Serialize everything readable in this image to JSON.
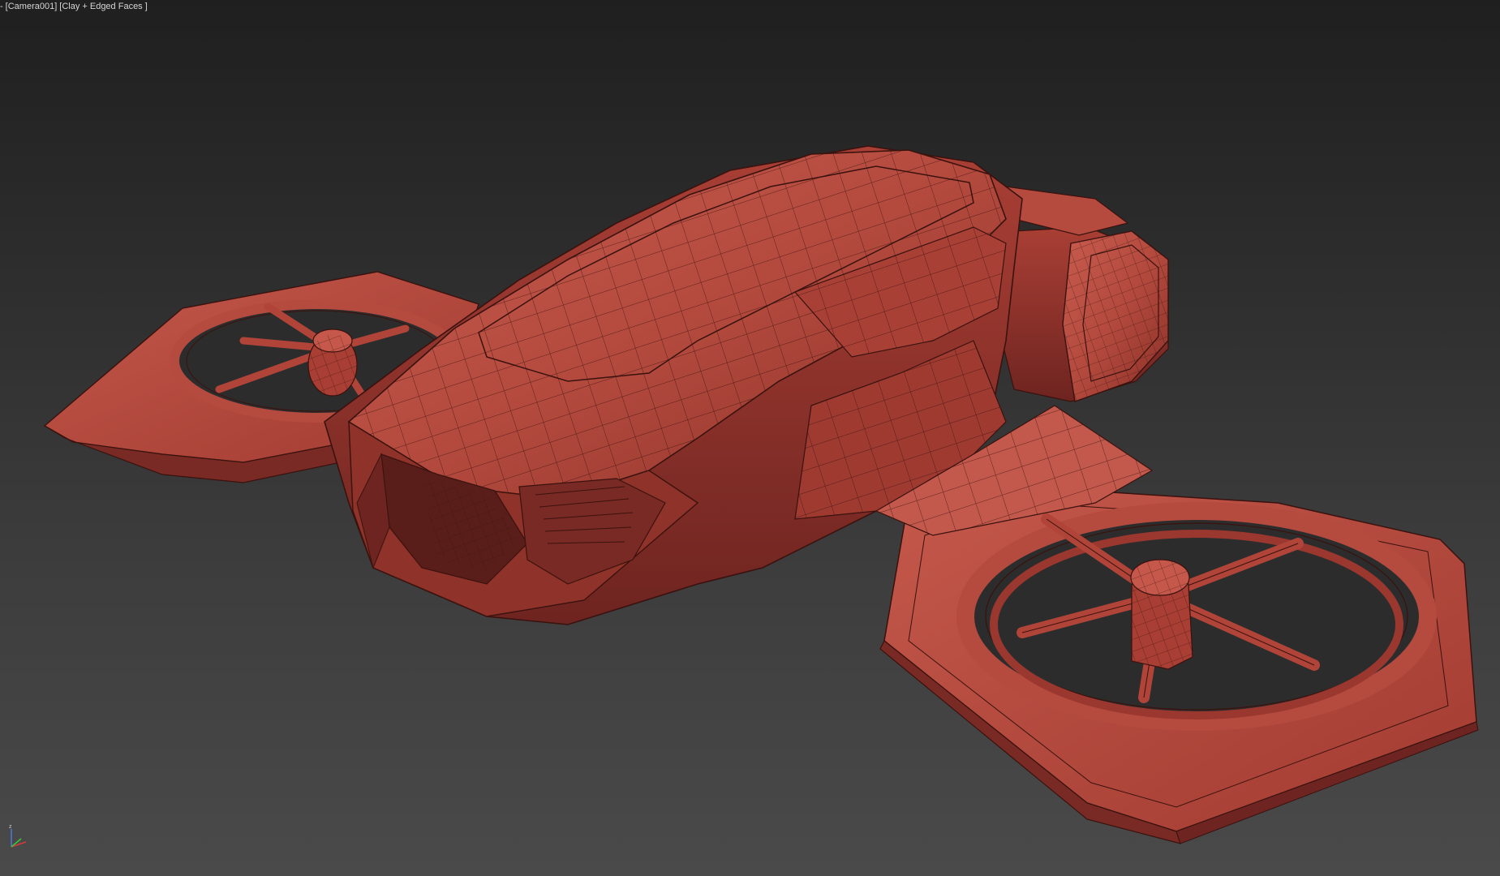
{
  "viewport": {
    "menu_label": "-",
    "camera_label": "[Camera001]",
    "shading_label": "[Clay + Edged Faces ]",
    "gizmo": {
      "z_label": "z",
      "axis_colors": {
        "x": "#d83a3a",
        "y": "#3ac83a",
        "z": "#4a7ad8"
      }
    }
  },
  "colors": {
    "clay": "#b5473c",
    "clay_light": "#c85548",
    "clay_dark": "#7a2a24",
    "wire": "#3a120e"
  }
}
